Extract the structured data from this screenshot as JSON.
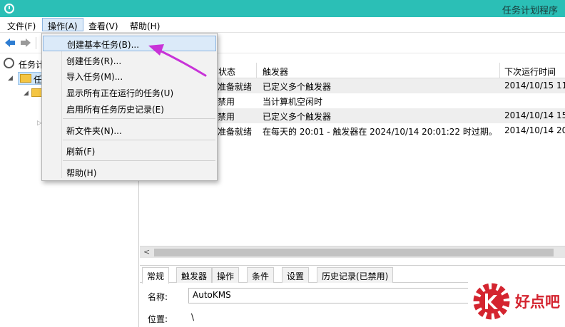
{
  "window": {
    "title": "任务计划程序"
  },
  "menubar": [
    {
      "label": "文件(F)"
    },
    {
      "label": "操作(A)"
    },
    {
      "label": "查看(V)"
    },
    {
      "label": "帮助(H)"
    }
  ],
  "tree": {
    "root_label": "任务计",
    "selected_label": "任"
  },
  "action_menu": {
    "items": [
      {
        "label": "创建基本任务(B)..."
      },
      {
        "label": "创建任务(R)..."
      },
      {
        "label": "导入任务(M)..."
      },
      {
        "label": "显示所有正在运行的任务(U)"
      },
      {
        "label": "启用所有任务历史记录(E)"
      },
      {
        "label": "新文件夹(N)..."
      },
      {
        "label": "刷新(F)"
      },
      {
        "label": "帮助(H)"
      }
    ]
  },
  "task_list": {
    "columns": [
      "状态",
      "触发器",
      "下次运行时间"
    ],
    "rows": [
      {
        "status": "准备就绪",
        "trigger": "已定义多个触发器",
        "next_run": "2014/10/15 11"
      },
      {
        "status": "禁用",
        "trigger": "当计算机空闲时",
        "next_run": ""
      },
      {
        "status": "禁用",
        "trigger": "已定义多个触发器",
        "next_run": "2014/10/14 15"
      },
      {
        "status": "准备就绪",
        "trigger": "在每天的 20:01 - 触发器在 2024/10/14 20:01:22 时过期。",
        "next_run": "2014/10/14 20"
      }
    ]
  },
  "detail": {
    "tabs": [
      "常规",
      "触发器",
      "操作",
      "条件",
      "设置",
      "历史记录(已禁用)"
    ],
    "name_label": "名称:",
    "name_value": "AutoKMS",
    "location_label": "位置:",
    "location_value": "\\"
  },
  "watermark": {
    "text": "好点吧"
  },
  "colors": {
    "titlebar": "#2bbfb6",
    "menu_hover": "#dbeaf9",
    "arrow": "#c833d8",
    "logo": "#d4242f"
  }
}
